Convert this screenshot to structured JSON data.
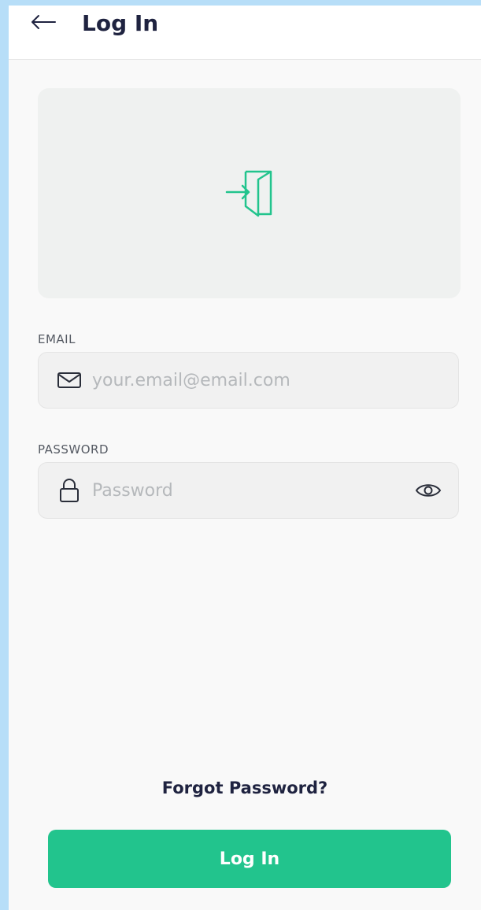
{
  "header": {
    "title": "Log In"
  },
  "email": {
    "label": "EMAIL",
    "placeholder": "your.email@email.com",
    "value": ""
  },
  "password": {
    "label": "PASSWORD",
    "placeholder": "Password",
    "value": ""
  },
  "links": {
    "forgot_password": "Forgot Password?"
  },
  "actions": {
    "login_label": "Log In"
  },
  "icons": {
    "back": "arrow-left-icon",
    "hero": "login-door-icon",
    "email": "envelope-icon",
    "password": "lock-icon",
    "toggle": "eye-icon"
  },
  "colors": {
    "accent": "#22c48d",
    "title_text": "#1f2340",
    "placeholder": "#b5b8bb"
  }
}
